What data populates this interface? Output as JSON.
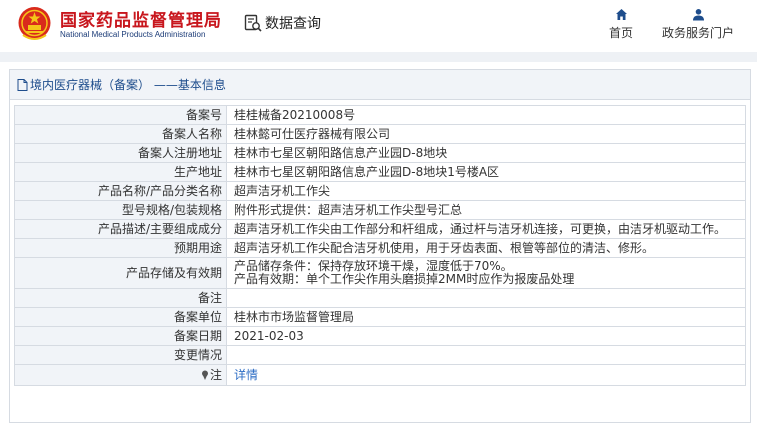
{
  "header": {
    "logo_cn": "国家药品监督管理局",
    "logo_en": "National Medical Products Administration",
    "query_label": "数据查询",
    "nav": [
      {
        "label": "首页",
        "icon": "home-icon"
      },
      {
        "label": "政务服务门户",
        "icon": "user-icon"
      }
    ]
  },
  "panel": {
    "title": "境内医疗器械（备案） ——基本信息"
  },
  "rows": [
    {
      "key": "备案号",
      "value": "桂桂械备20210008号"
    },
    {
      "key": "备案人名称",
      "value": "桂林懿可仕医疗器械有限公司"
    },
    {
      "key": "备案人注册地址",
      "value": "桂林市七星区朝阳路信息产业园D-8地块"
    },
    {
      "key": "生产地址",
      "value": "桂林市七星区朝阳路信息产业园D-8地块1号楼A区"
    },
    {
      "key": "产品名称/产品分类名称",
      "value": "超声洁牙机工作尖"
    },
    {
      "key": "型号规格/包装规格",
      "value": "附件形式提供：超声洁牙机工作尖型号汇总"
    },
    {
      "key": "产品描述/主要组成成分",
      "value": "超声洁牙机工作尖由工作部分和杆组成，通过杆与洁牙机连接，可更换，由洁牙机驱动工作。"
    },
    {
      "key": "预期用途",
      "value": "超声洁牙机工作尖配合洁牙机使用，用于牙齿表面、根管等部位的清洁、修形。"
    },
    {
      "key": "产品存储及有效期",
      "value_line1": "产品储存条件：保持存放环境干燥，湿度低于70%。",
      "value_line2": "产品有效期：单个工作尖作用头磨损掉2MM时应作为报废品处理"
    },
    {
      "key": "备注",
      "value": ""
    },
    {
      "key": "备案单位",
      "value": "桂林市市场监督管理局"
    },
    {
      "key": "备案日期",
      "value": "2021-02-03"
    },
    {
      "key": "变更情况",
      "value": ""
    },
    {
      "key": "注",
      "value": "详情",
      "icon": "pin-icon"
    }
  ],
  "colors": {
    "brand_red": "#c8161d",
    "brand_blue": "#1c3c78",
    "title_blue": "#1e4d8c",
    "link_blue": "#2b6cc4",
    "key_bg": "#f1f4f8",
    "border": "#d6dbe2"
  }
}
